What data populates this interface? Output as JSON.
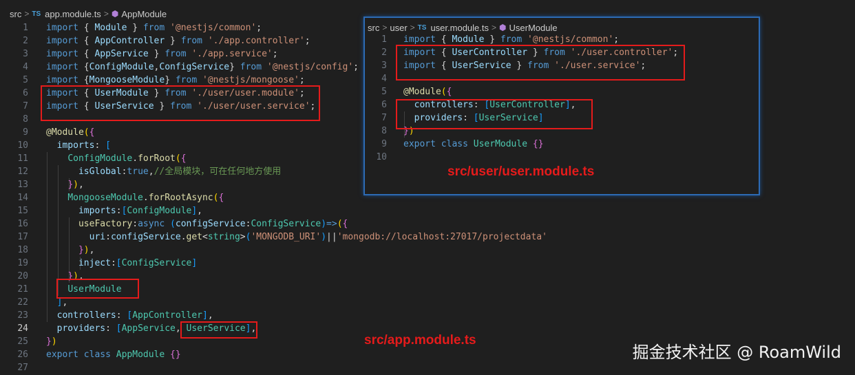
{
  "main": {
    "breadcrumb": {
      "folder": "src",
      "file_badge": "TS",
      "file": "app.module.ts",
      "symbol": "AppModule"
    },
    "lines": [
      {
        "n": "1",
        "html": "<span class='k'>import</span> <span class='p'>{</span> <span class='v'>Module</span> <span class='p'>}</span> <span class='k'>from</span> <span class='s'>'@nestjs/common'</span>;"
      },
      {
        "n": "2",
        "html": "<span class='k'>import</span> <span class='p'>{</span> <span class='v'>AppController</span> <span class='p'>}</span> <span class='k'>from</span> <span class='s'>'./app.controller'</span>;"
      },
      {
        "n": "3",
        "html": "<span class='k'>import</span> <span class='p'>{</span> <span class='v'>AppService</span> <span class='p'>}</span> <span class='k'>from</span> <span class='s'>'./app.service'</span>;"
      },
      {
        "n": "4",
        "html": "<span class='k'>import</span> <span class='p'>{</span><span class='v'>ConfigModule</span>,<span class='v'>ConfigService</span><span class='p'>}</span> <span class='k'>from</span> <span class='s'>'@nestjs/config'</span>;"
      },
      {
        "n": "5",
        "html": "<span class='k'>import</span> <span class='p'>{</span><span class='v'>MongooseModule</span><span class='p'>}</span> <span class='k'>from</span> <span class='s'>'@nestjs/mongoose'</span>;"
      },
      {
        "n": "6",
        "html": "<span class='k'>import</span> <span class='p'>{</span> <span class='v'>UserModule</span> <span class='p'>}</span> <span class='k'>from</span> <span class='s'>'./user/user.module'</span>;"
      },
      {
        "n": "7",
        "html": "<span class='k'>import</span> <span class='p'>{</span> <span class='v'>UserService</span> <span class='p'>}</span> <span class='k'>from</span> <span class='s'>'./user/user.service'</span>;"
      },
      {
        "n": "8",
        "html": ""
      },
      {
        "n": "9",
        "html": "<span class='f'>@Module</span><span class='b'>(</span><span class='b2'>{</span>"
      },
      {
        "n": "10",
        "html": "  <span class='v'>imports</span>: <span class='b3'>[</span>"
      },
      {
        "n": "11",
        "html": "    <span class='t'>ConfigModule</span>.<span class='f'>forRoot</span><span class='b'>(</span><span class='b2'>{</span>"
      },
      {
        "n": "12",
        "html": "      <span class='v'>isGlobal</span>:<span class='k'>true</span>,<span class='c'>//全局模块，可在任何地方使用</span>"
      },
      {
        "n": "13",
        "html": "    <span class='b2'>}</span><span class='b'>)</span>,"
      },
      {
        "n": "14",
        "html": "    <span class='t'>MongooseModule</span>.<span class='f'>forRootAsync</span><span class='b'>(</span><span class='b2'>{</span>"
      },
      {
        "n": "15",
        "html": "      <span class='v'>imports</span>:<span class='b3'>[</span><span class='t'>ConfigModule</span><span class='b3'>]</span>,"
      },
      {
        "n": "16",
        "html": "      <span class='f'>useFactory</span>:<span class='k'>async</span> <span class='b3'>(</span><span class='v'>configService</span>:<span class='t'>ConfigService</span><span class='b3'>)</span><span class='k'>=&gt;</span><span class='b'>(</span><span class='b2'>{</span>"
      },
      {
        "n": "17",
        "html": "        <span class='v'>uri</span>:<span class='v'>configService</span>.<span class='f'>get</span><span class='p'>&lt;</span><span class='t'>string</span><span class='p'>&gt;</span><span class='b3'>(</span><span class='s'>'MONGODB_URI'</span><span class='b3'>)</span>||<span class='s'>'mongodb://localhost:27017/projectdata'</span>"
      },
      {
        "n": "18",
        "html": "      <span class='b2'>}</span><span class='b'>)</span>,"
      },
      {
        "n": "19",
        "html": "      <span class='v'>inject</span>:<span class='b3'>[</span><span class='t'>ConfigService</span><span class='b3'>]</span>"
      },
      {
        "n": "20",
        "html": "    <span class='b2'>}</span><span class='b'>)</span>,"
      },
      {
        "n": "21",
        "html": "    <span class='t'>UserModule</span>"
      },
      {
        "n": "22",
        "html": "  <span class='b3'>]</span>,"
      },
      {
        "n": "23",
        "html": "  <span class='v'>controllers</span>: <span class='b3'>[</span><span class='t'>AppController</span><span class='b3'>]</span>,"
      },
      {
        "n": "24",
        "html": "  <span class='v'>providers</span>: <span class='b3'>[</span><span class='t'>AppService</span>, <span class='t'>UserService</span><span class='b3'>]</span>,"
      },
      {
        "n": "25",
        "html": "<span class='b2'>}</span><span class='b'>)</span>"
      },
      {
        "n": "26",
        "html": "<span class='k'>export</span> <span class='k'>class</span> <span class='t'>AppModule</span> <span class='b2'>{}</span>"
      },
      {
        "n": "27",
        "html": ""
      }
    ],
    "caption": "src/app.module.ts"
  },
  "panel": {
    "breadcrumb": {
      "folder": "src",
      "subfolder": "user",
      "file_badge": "TS",
      "file": "user.module.ts",
      "symbol": "UserModule"
    },
    "lines": [
      {
        "n": "1",
        "html": "<span class='k'>import</span> <span class='p'>{</span> <span class='v'>Module</span> <span class='p'>}</span> <span class='k'>from</span> <span class='s'>'@nestjs/common'</span>;"
      },
      {
        "n": "2",
        "html": "<span class='k'>import</span> <span class='p'>{</span> <span class='v'>UserController</span> <span class='p'>}</span> <span class='k'>from</span> <span class='s'>'./user.controller'</span>;"
      },
      {
        "n": "3",
        "html": "<span class='k'>import</span> <span class='p'>{</span> <span class='v'>UserService</span> <span class='p'>}</span> <span class='k'>from</span> <span class='s'>'./user.service'</span>;"
      },
      {
        "n": "4",
        "html": ""
      },
      {
        "n": "5",
        "html": "<span class='f'>@Module</span><span class='b'>(</span><span class='b2'>{</span>"
      },
      {
        "n": "6",
        "html": "  <span class='v'>controllers</span>: <span class='b3'>[</span><span class='t'>UserController</span><span class='b3'>]</span>,"
      },
      {
        "n": "7",
        "html": "  <span class='v'>providers</span>: <span class='b3'>[</span><span class='t'>UserService</span><span class='b3'>]</span>"
      },
      {
        "n": "8",
        "html": "<span class='b2'>}</span><span class='b'>)</span>"
      },
      {
        "n": "9",
        "html": "<span class='k'>export</span> <span class='k'>class</span> <span class='t'>UserModule</span> <span class='b2'>{}</span>"
      },
      {
        "n": "10",
        "html": ""
      }
    ],
    "caption": "src/user/user.module.ts"
  },
  "watermark": "掘金技术社区 @ RoamWild",
  "colors": {
    "highlight_box": "#e51b1b",
    "panel_border": "#2d6bb5",
    "background": "#1f1f1f"
  }
}
